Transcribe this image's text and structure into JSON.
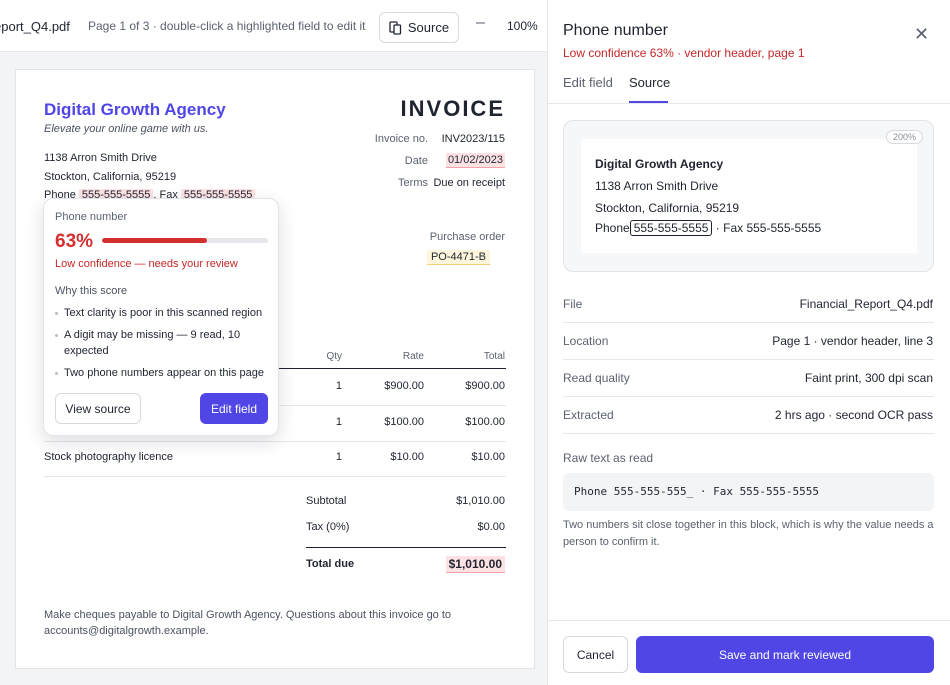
{
  "viewer": {
    "file_name": "eport_Q4.pdf",
    "page_info": "Page 1 of 3 · double-click a highlighted field to edit it",
    "source_button": "Source",
    "zoom_out_symbol": "–",
    "zoom": "100%"
  },
  "invoice": {
    "agency": "Digital Growth Agency",
    "tagline": "Elevate your online game with us.",
    "address_line1": "1138 Arron Smith Drive",
    "address_line2": "Stockton, California, 95219",
    "phone_label": "Phone",
    "phone_value": "555-555-5555",
    "fax_label": "Fax",
    "fax_value": "555-555-5555",
    "title": "INVOICE",
    "invoice_no_label": "Invoice no.",
    "invoice_no": "INV2023/115",
    "date_label": "Date",
    "date": "01/02/2023",
    "terms_label": "Terms",
    "terms": "Due on receipt",
    "po_label": "Purchase order",
    "po_value": "PO-4471-B",
    "columns": {
      "qty": "Qty",
      "rate": "Rate",
      "total": "Total"
    },
    "rows": [
      {
        "description": "",
        "qty": "1",
        "rate": "$900.00",
        "total": "$900.00"
      },
      {
        "description": "",
        "qty": "1",
        "rate": "$100.00",
        "total": "$100.00"
      },
      {
        "description": "Stock photography licence",
        "qty": "1",
        "rate": "$10.00",
        "total": "$10.00"
      }
    ],
    "subtotal_label": "Subtotal",
    "subtotal": "$1,010.00",
    "tax_label": "Tax (0%)",
    "tax": "$0.00",
    "total_due_label": "Total due",
    "total_due": "$1,010.00",
    "footer": "Make cheques payable to Digital Growth Agency. Questions about this invoice go to accounts@digitalgrowth.example."
  },
  "popover": {
    "label": "Phone number",
    "confidence_text": "63%",
    "confidence": 0.63,
    "warning": "Low confidence — needs your review",
    "why_title": "Why this score",
    "reasons": [
      "Text clarity is poor in this scanned region",
      "A digit may be missing — 9 read, 10 expected",
      "Two phone numbers appear on this page"
    ],
    "view_source": "View source",
    "edit_field": "Edit field"
  },
  "panel": {
    "title": "Phone number",
    "close_symbol": "✕",
    "subtitle": "Low confidence 63% · vendor header, page 1",
    "tabs": [
      "Edit field",
      "Source"
    ],
    "active_tab": "Source",
    "source_zoom": "200%",
    "source_name": "Digital Growth Agency",
    "source_line1": "1138 Arron Smith Drive",
    "source_line2": "Stockton, California, 95219",
    "source_phone_label": "Phone",
    "source_phone": "555-555-5555",
    "source_fax": "· Fax 555-555-5555",
    "details": [
      {
        "label": "File",
        "value": "Financial_Report_Q4.pdf"
      },
      {
        "label": "Location",
        "value": "Page 1 · vendor header, line 3"
      },
      {
        "label": "Read quality",
        "value": "Faint print, 300 dpi scan"
      },
      {
        "label": "Extracted",
        "value": "2 hrs ago · second OCR pass"
      }
    ],
    "raw_label": "Raw text as read",
    "raw_text": "Phone 555-555-555_ · Fax 555-555-5555",
    "raw_note": "Two numbers sit close together in this block, which is why the value needs a person to confirm it.",
    "cancel": "Cancel",
    "save": "Save and mark reviewed"
  },
  "colors": {
    "accent": "#4f46e5",
    "danger": "#d32f2f",
    "highlight": "#fde2e4",
    "po_highlight": "#fdf6dc"
  }
}
